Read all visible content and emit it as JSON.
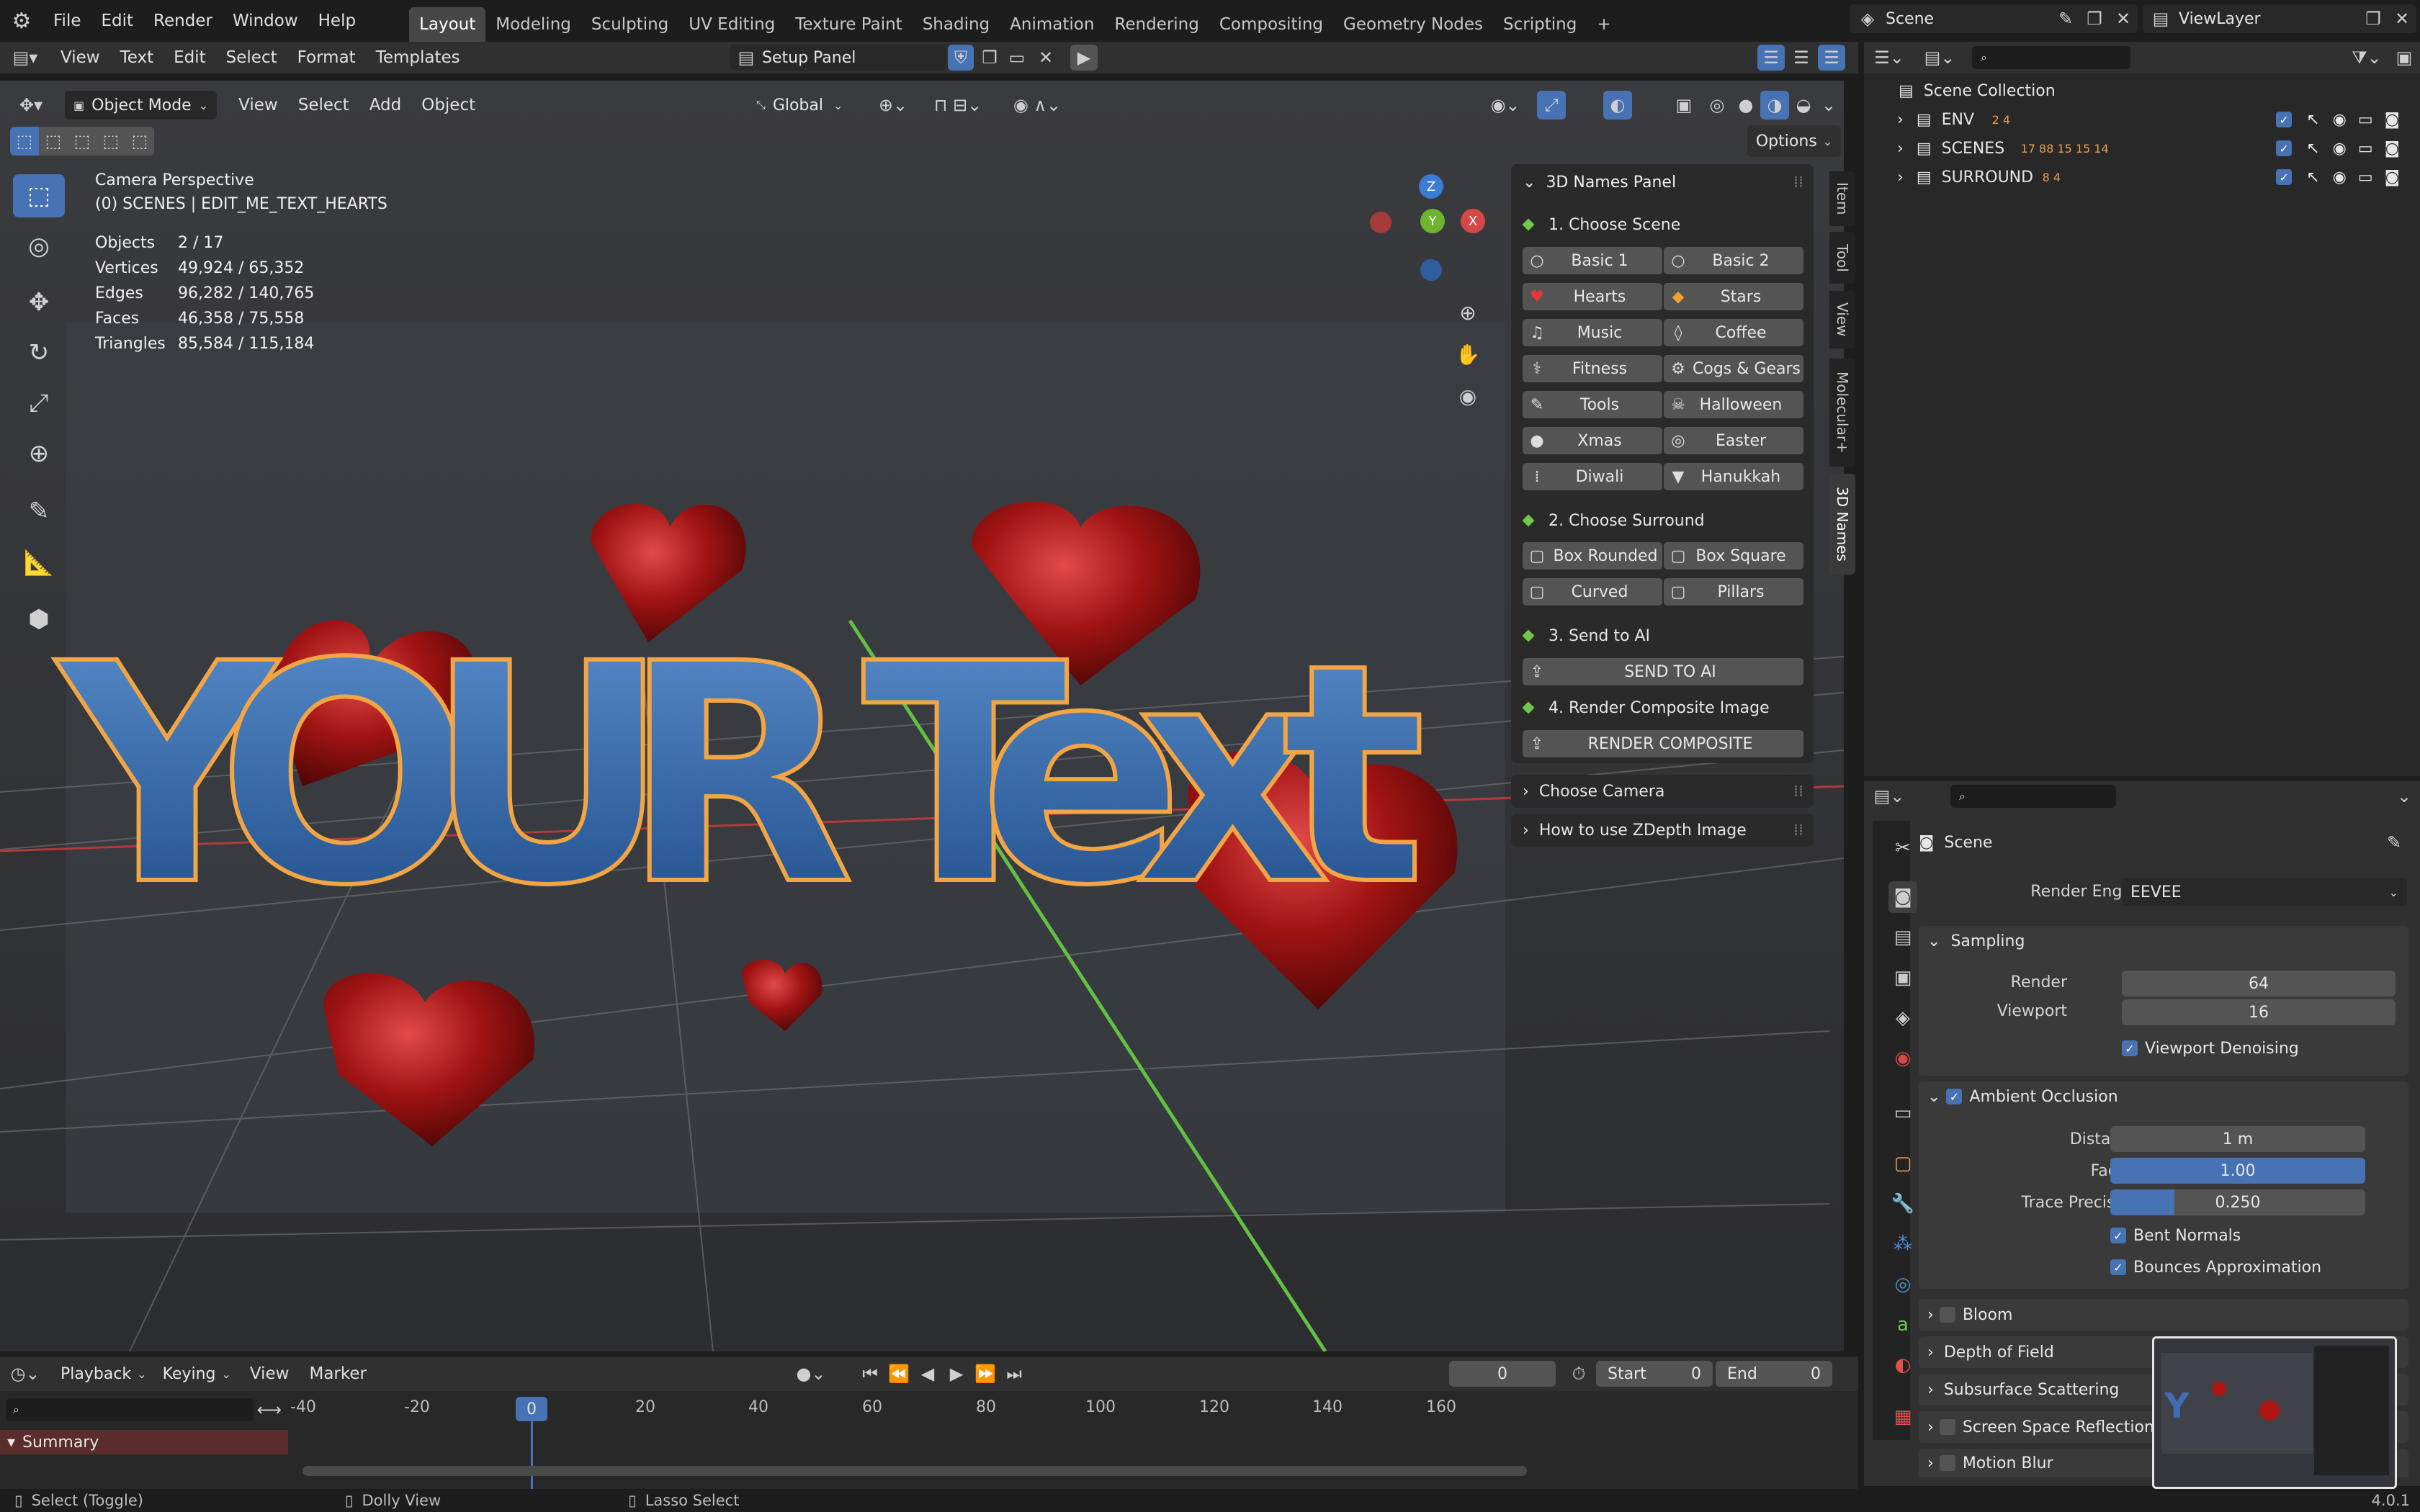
{
  "topbar": {
    "menus": [
      "File",
      "Edit",
      "Render",
      "Window",
      "Help"
    ],
    "workspaces": [
      "Layout",
      "Modeling",
      "Sculpting",
      "UV Editing",
      "Texture Paint",
      "Shading",
      "Animation",
      "Rendering",
      "Compositing",
      "Geometry Nodes",
      "Scripting"
    ],
    "active_workspace": "Layout",
    "scene": "Scene",
    "view_layer": "ViewLayer"
  },
  "text_editor": {
    "menus": [
      "View",
      "Text",
      "Edit",
      "Select",
      "Format",
      "Templates"
    ],
    "file": "Setup Panel"
  },
  "viewport": {
    "mode": "Object Mode",
    "menus": [
      "View",
      "Select",
      "Add",
      "Object"
    ],
    "orientation": "Global",
    "options": "Options",
    "overlay": {
      "title": "Camera Perspective",
      "subtitle": "(0) SCENES | EDIT_ME_TEXT_HEARTS",
      "stats": [
        {
          "label": "Objects",
          "value": "2 / 17"
        },
        {
          "label": "Vertices",
          "value": "49,924 / 65,352"
        },
        {
          "label": "Edges",
          "value": "96,282 / 140,765"
        },
        {
          "label": "Faces",
          "value": "46,358 / 75,558"
        },
        {
          "label": "Triangles",
          "value": "85,584 / 115,184"
        }
      ]
    },
    "scene_text": "YOUR Text",
    "gizmo": {
      "z": "Z",
      "y": "Y",
      "x": "X"
    }
  },
  "names_panel": {
    "title": "3D Names Panel",
    "step1": "1. Choose Scene",
    "scenes": [
      {
        "icon": "○",
        "label": "Basic 1"
      },
      {
        "icon": "○",
        "label": "Basic 2"
      },
      {
        "icon": "♥",
        "label": "Hearts"
      },
      {
        "icon": "◆",
        "label": "Stars"
      },
      {
        "icon": "♫",
        "label": "Music"
      },
      {
        "icon": "◊",
        "label": "Coffee"
      },
      {
        "icon": "⚕",
        "label": "Fitness"
      },
      {
        "icon": "⚙",
        "label": "Cogs & Gears"
      },
      {
        "icon": "✎",
        "label": "Tools"
      },
      {
        "icon": "☠",
        "label": "Halloween"
      },
      {
        "icon": "●",
        "label": "Xmas"
      },
      {
        "icon": "◎",
        "label": "Easter"
      },
      {
        "icon": "⁞",
        "label": "Diwali"
      },
      {
        "icon": "▼",
        "label": "Hanukkah"
      }
    ],
    "step2": "2. Choose Surround",
    "surrounds": [
      {
        "icon": "▢",
        "label": "Box Rounded"
      },
      {
        "icon": "▢",
        "label": "Box Square"
      },
      {
        "icon": "▢",
        "label": "Curved"
      },
      {
        "icon": "▢",
        "label": "Pillars"
      }
    ],
    "step3": "3. Send to AI",
    "send_button": "SEND TO AI",
    "step4": "4. Render Composite Image",
    "render_button": "RENDER COMPOSITE",
    "choose_camera": "Choose Camera",
    "zdepth": "How to use ZDepth Image"
  },
  "sidebar_tabs": [
    "Item",
    "Tool",
    "View",
    "Molecular+",
    "3D Names"
  ],
  "outliner": {
    "root": "Scene Collection",
    "items": [
      {
        "name": "ENV",
        "badge": "2 4"
      },
      {
        "name": "SCENES",
        "badge": "17 88 15 15 14"
      },
      {
        "name": "SURROUND",
        "badge": "8 4"
      }
    ]
  },
  "properties": {
    "context": "Scene",
    "render_engine_label": "Render Engine",
    "render_engine": "EEVEE",
    "sampling": {
      "title": "Sampling",
      "render_label": "Render",
      "render": "64",
      "viewport_label": "Viewport",
      "viewport": "16",
      "denoise": "Viewport Denoising"
    },
    "ao": {
      "title": "Ambient Occlusion",
      "distance_label": "Distance",
      "distance": "1 m",
      "factor_label": "Factor",
      "factor": "1.00",
      "trace_label": "Trace Precision",
      "trace": "0.250",
      "trace_fill": 0.25,
      "bent": "Bent Normals",
      "bounces": "Bounces Approximation"
    },
    "collapsed": [
      "Bloom",
      "Depth of Field",
      "Subsurface Scattering",
      "Screen Space Reflections",
      "Motion Blur"
    ]
  },
  "timeline": {
    "menus": [
      "Playback",
      "Keying",
      "View",
      "Marker"
    ],
    "frame": "0",
    "start_label": "Start",
    "start": "0",
    "end_label": "End",
    "end": "0",
    "ticks": [
      "-40",
      "-20",
      "0",
      "20",
      "40",
      "60",
      "80",
      "100",
      "120",
      "140",
      "160"
    ],
    "summary": "Summary"
  },
  "statusbar": {
    "items": [
      "Select (Toggle)",
      "Dolly View",
      "Lasso Select"
    ],
    "version": "4.0.1"
  }
}
